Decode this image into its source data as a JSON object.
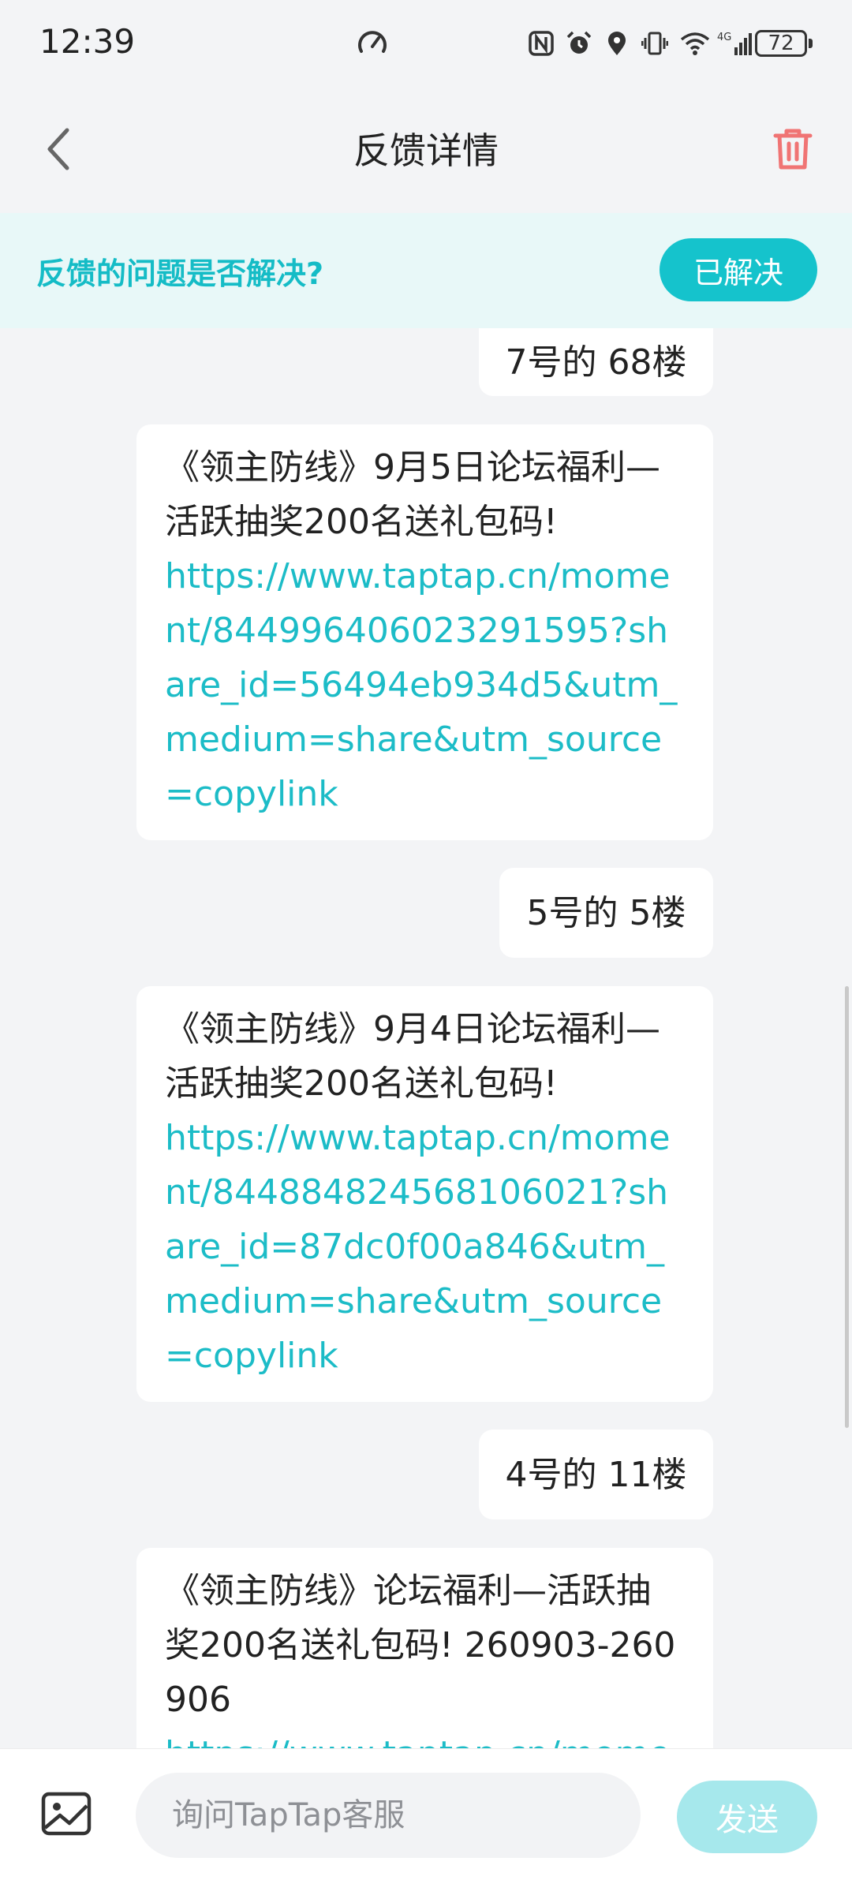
{
  "status_bar": {
    "time": "12:39",
    "battery": "72",
    "icons": [
      "speed-icon",
      "nfc-icon",
      "alarm-icon",
      "location-icon",
      "vibrate-icon",
      "wifi-icon",
      "signal-4g-icon",
      "battery-icon"
    ]
  },
  "header": {
    "title": "反馈详情",
    "back_icon": "chevron-left-icon",
    "delete_icon": "trash-icon"
  },
  "banner": {
    "question": "反馈的问题是否解决?",
    "resolved_label": "已解决"
  },
  "messages": [
    {
      "text": "7号的 68楼"
    },
    {
      "text": "《领主防线》9月5日论坛福利—活跃抽奖200名送礼包码!",
      "link": "https://www.taptap.cn/moment/844996406023291595?share_id=56494eb934d5&utm_medium=share&utm_source=copylink"
    },
    {
      "text": "5号的 5楼"
    },
    {
      "text": "《领主防线》9月4日论坛福利—活跃抽奖200名送礼包码!",
      "link": "https://www.taptap.cn/moment/844884824568106021?share_id=87dc0f00a846&utm_medium=share&utm_source=copylink"
    },
    {
      "text": "4号的 11楼"
    },
    {
      "text": "《领主防线》论坛福利—活跃抽奖200名送礼包码! 260903-260906",
      "link": "https://www.taptap.cn/moment"
    }
  ],
  "composer": {
    "placeholder": "询问TapTap客服",
    "send_label": "发送",
    "image_icon": "image-icon"
  },
  "colors": {
    "accent": "#15c3cc",
    "link": "#1cbcc7",
    "delete": "#f07474",
    "banner_bg": "#e8f8f8",
    "send_disabled": "#a6e8ec"
  }
}
